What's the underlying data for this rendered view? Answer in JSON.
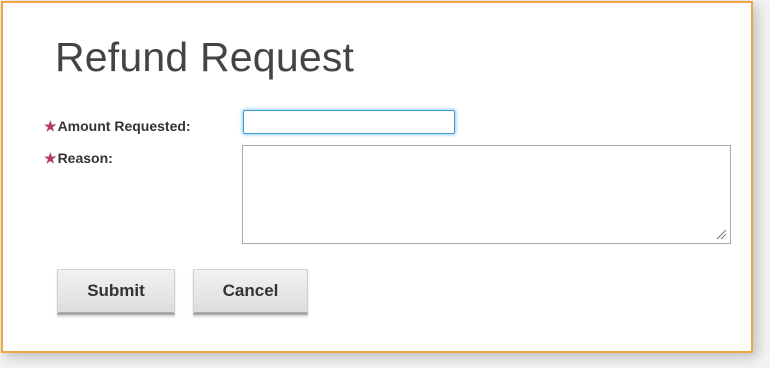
{
  "form": {
    "title": "Refund Request",
    "required_marker": "★",
    "amount": {
      "label": "Amount Requested:",
      "value": ""
    },
    "reason": {
      "label": "Reason:",
      "value": ""
    },
    "submit_label": "Submit",
    "cancel_label": "Cancel"
  },
  "colors": {
    "border_accent": "#f0a640",
    "required_star": "#b33a6a",
    "focus_ring": "#3a9fd6"
  }
}
